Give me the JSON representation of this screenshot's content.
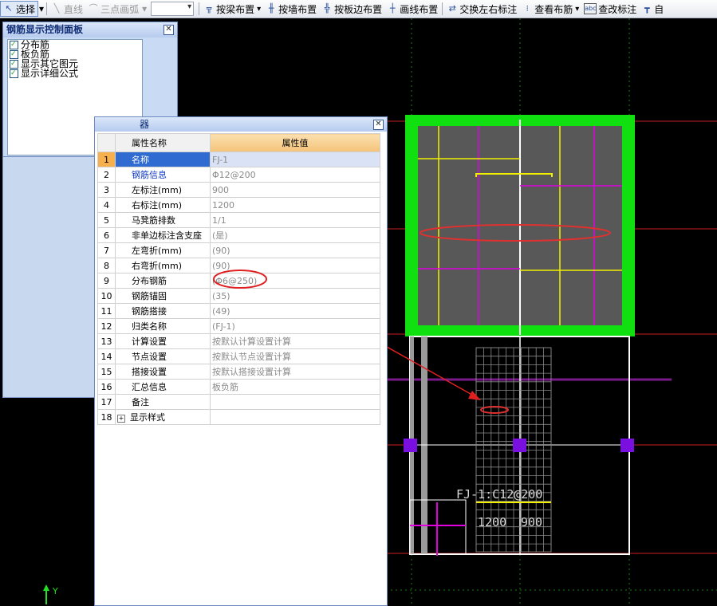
{
  "toolbar": {
    "select_label": "选择",
    "line_label": "直线",
    "arc_label": "三点画弧",
    "beam_label": "按梁布置",
    "wall_label": "按墙布置",
    "slab_edge_label": "按板边布置",
    "draw_line_label": "画线布置",
    "swap_label": "交换左右标注",
    "view_label": "查看布筋",
    "edit_label": "查改标注",
    "auto_label": "自"
  },
  "control_panel": {
    "title": "钢筋显示控制面板",
    "items": [
      "分布筋",
      "板负筋",
      "显示其它图元",
      "显示详细公式"
    ]
  },
  "property_panel": {
    "title": "器",
    "col_name": "属性名称",
    "col_value": "属性值",
    "rows": [
      {
        "no": "1",
        "name": "名称",
        "value": "FJ-1"
      },
      {
        "no": "2",
        "name": "钢筋信息",
        "value": "Φ12@200"
      },
      {
        "no": "3",
        "name": "左标注(mm)",
        "value": "900"
      },
      {
        "no": "4",
        "name": "右标注(mm)",
        "value": "1200"
      },
      {
        "no": "5",
        "name": "马凳筋排数",
        "value": "1/1"
      },
      {
        "no": "6",
        "name": "非单边标注含支座",
        "value": "(是)"
      },
      {
        "no": "7",
        "name": "左弯折(mm)",
        "value": "(90)"
      },
      {
        "no": "8",
        "name": "右弯折(mm)",
        "value": "(90)"
      },
      {
        "no": "9",
        "name": "分布钢筋",
        "value": "(Φ6@250)"
      },
      {
        "no": "10",
        "name": "钢筋锚固",
        "value": "(35)"
      },
      {
        "no": "11",
        "name": "钢筋搭接",
        "value": "(49)"
      },
      {
        "no": "12",
        "name": "归类名称",
        "value": "(FJ-1)"
      },
      {
        "no": "13",
        "name": "计算设置",
        "value": "按默认计算设置计算"
      },
      {
        "no": "14",
        "name": "节点设置",
        "value": "按默认节点设置计算"
      },
      {
        "no": "15",
        "name": "搭接设置",
        "value": "按默认搭接设置计算"
      },
      {
        "no": "16",
        "name": "汇总信息",
        "value": "板负筋"
      },
      {
        "no": "17",
        "name": "备注",
        "value": ""
      },
      {
        "no": "18",
        "name": "显示样式",
        "value": ""
      }
    ]
  },
  "drawing": {
    "label_top": "FJ-1:C12@200",
    "label_left": "1200",
    "label_right": "900",
    "axis_label": "Y"
  },
  "colors": {
    "slab_green": "#10e010",
    "highlight_red": "#e03030",
    "rebar_yellow": "#f0f000",
    "rebar_magenta": "#e000e0"
  }
}
